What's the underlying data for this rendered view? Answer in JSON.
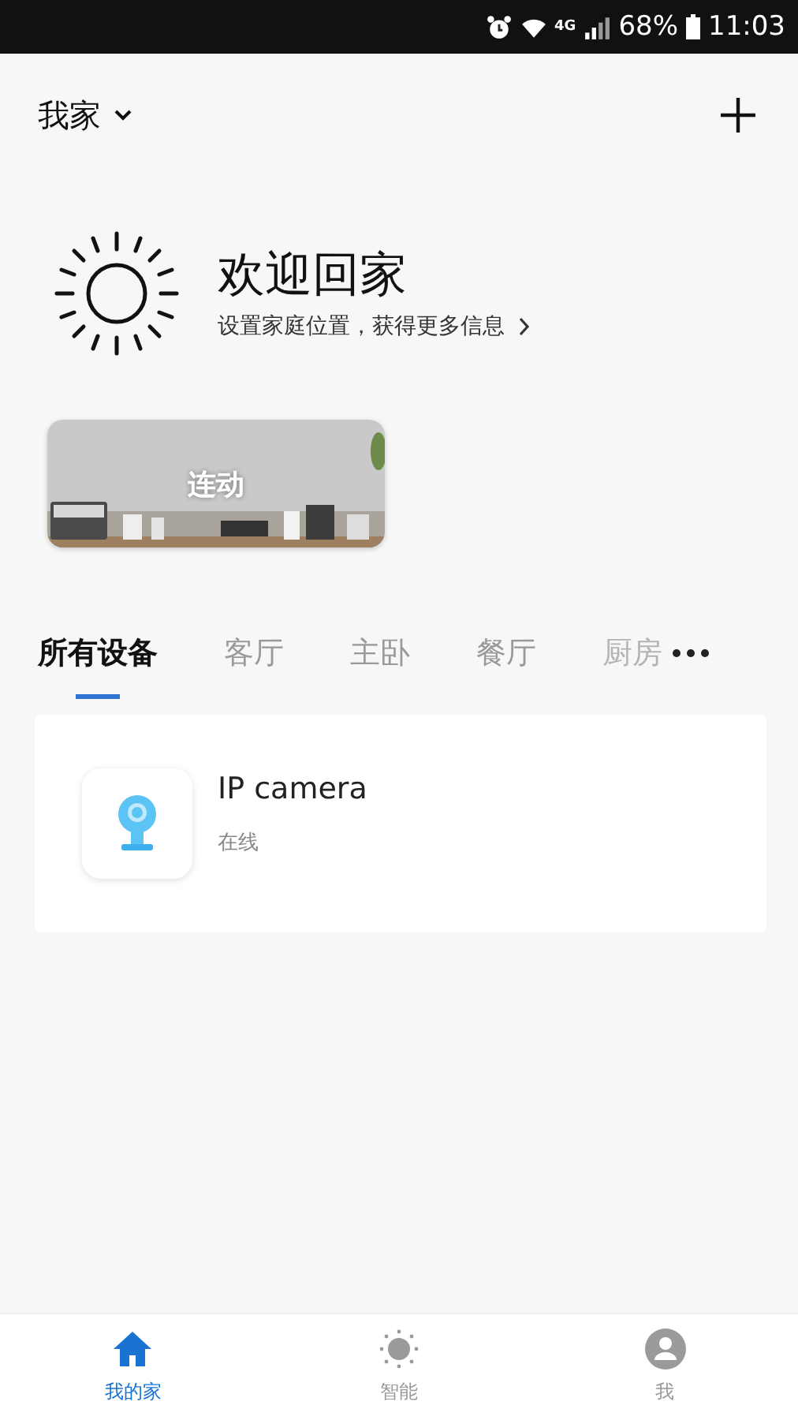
{
  "status_bar": {
    "network": "4G",
    "battery": "68%",
    "time": "11:03"
  },
  "header": {
    "home_name": "我家"
  },
  "welcome": {
    "title": "欢迎回家",
    "subtitle": "设置家庭位置，获得更多信息"
  },
  "scenes": [
    {
      "label": "连动",
      "kind": "picture"
    }
  ],
  "room_tabs": [
    {
      "label": "所有设备",
      "selected": true,
      "faded": false
    },
    {
      "label": "客厅",
      "selected": false,
      "faded": false
    },
    {
      "label": "主卧",
      "selected": false,
      "faded": false
    },
    {
      "label": "餐厅",
      "selected": false,
      "faded": false
    },
    {
      "label": "厨房",
      "selected": false,
      "faded": true
    }
  ],
  "devices": [
    {
      "name": "IP camera",
      "status": "在线"
    }
  ],
  "bottom_nav": [
    {
      "label": "我的家",
      "kind": "home",
      "selected": true
    },
    {
      "label": "智能",
      "kind": "smart",
      "selected": false
    },
    {
      "label": "我",
      "kind": "me",
      "selected": false
    }
  ]
}
